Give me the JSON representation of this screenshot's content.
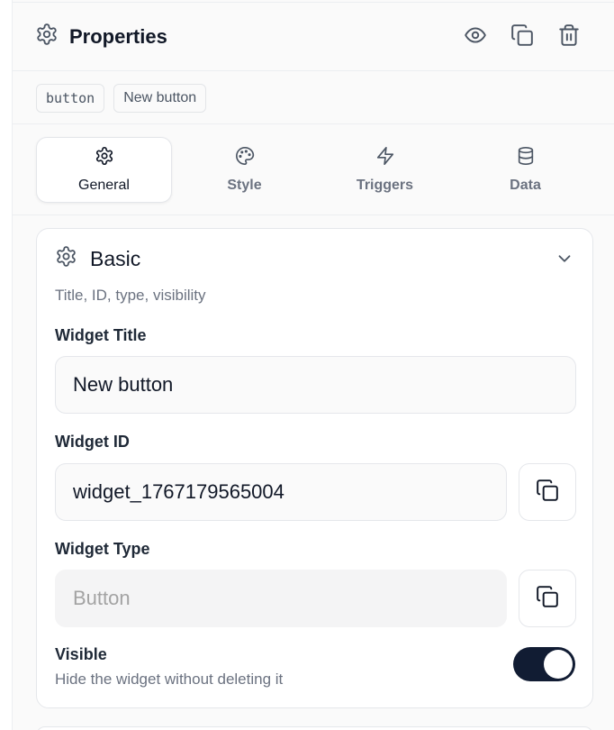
{
  "header": {
    "title": "Properties",
    "icons": [
      "gear-icon",
      "eye-icon",
      "copy-icon",
      "trash-icon"
    ]
  },
  "tags": {
    "type_tag": "button",
    "name_tag": "New button"
  },
  "tabs": [
    {
      "label": "General",
      "icon": "gear-icon",
      "active": true
    },
    {
      "label": "Style",
      "icon": "palette-icon",
      "active": false
    },
    {
      "label": "Triggers",
      "icon": "lightning-icon",
      "active": false
    },
    {
      "label": "Data",
      "icon": "database-icon",
      "active": false
    }
  ],
  "section": {
    "title": "Basic",
    "description": "Title, ID, type, visibility",
    "expanded": true,
    "widget_title": {
      "label": "Widget Title",
      "value": "New button"
    },
    "widget_id": {
      "label": "Widget ID",
      "value": "widget_1767179565004"
    },
    "widget_type": {
      "label": "Widget Type",
      "placeholder": "Button"
    },
    "visible": {
      "label": "Visible",
      "description": "Hide the widget without deleting it",
      "on": true
    }
  },
  "colors": {
    "toggle_on": "#111c33",
    "text_primary": "#111827",
    "text_muted": "#6b7280",
    "border": "#e5e7eb"
  }
}
